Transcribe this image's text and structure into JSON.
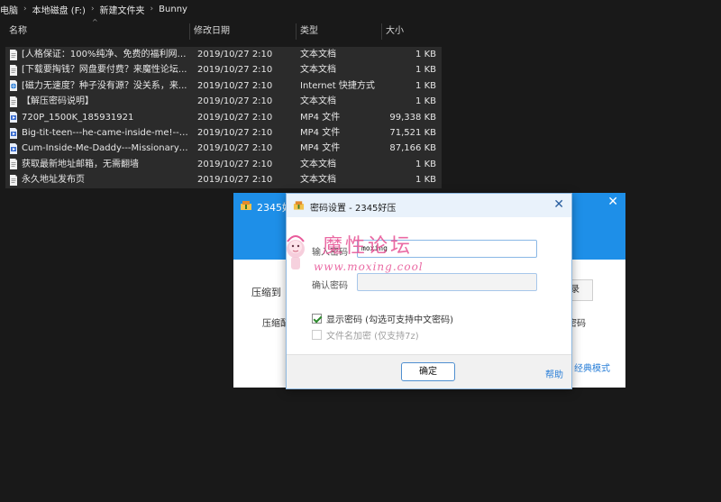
{
  "breadcrumb": [
    "电脑",
    "本地磁盘 (F:)",
    "新建文件夹",
    "Bunny"
  ],
  "columns": {
    "name": "名称",
    "date": "修改日期",
    "type": "类型",
    "size": "大小"
  },
  "files": [
    {
      "name": "[人格保证：100%纯净、免费的福利网站...",
      "date": "2019/10/27 2:10",
      "type": "文本文档",
      "size": "1 KB",
      "icon": "text-file-icon"
    },
    {
      "name": "[下载要掏钱？网盘要付费？来魔性论坛...",
      "date": "2019/10/27 2:10",
      "type": "文本文档",
      "size": "1 KB",
      "icon": "text-file-icon"
    },
    {
      "name": "[磁力无速度？种子没有源？没关系，来...",
      "date": "2019/10/27 2:10",
      "type": "Internet 快捷方式",
      "size": "1 KB",
      "icon": "internet-shortcut-icon"
    },
    {
      "name": "【解压密码说明】",
      "date": "2019/10/27 2:10",
      "type": "文本文档",
      "size": "1 KB",
      "icon": "text-file-icon"
    },
    {
      "name": "720P_1500K_185931921",
      "date": "2019/10/27 2:10",
      "type": "MP4 文件",
      "size": "99,338 KB",
      "icon": "video-file-icon"
    },
    {
      "name": "Big-tit-teen---he-came-inside-me!---...",
      "date": "2019/10/27 2:10",
      "type": "MP4 文件",
      "size": "71,521 KB",
      "icon": "video-file-icon"
    },
    {
      "name": "Cum-Inside-Me-Daddy---Missionary-...",
      "date": "2019/10/27 2:10",
      "type": "MP4 文件",
      "size": "87,166 KB",
      "icon": "video-file-icon"
    },
    {
      "name": "获取最新地址邮箱，无需翻墙",
      "date": "2019/10/27 2:10",
      "type": "文本文档",
      "size": "1 KB",
      "icon": "text-file-icon"
    },
    {
      "name": "永久地址发布页",
      "date": "2019/10/27 2:10",
      "type": "文本文档",
      "size": "1 KB",
      "icon": "text-file-icon"
    }
  ],
  "bg_window": {
    "title": "2345好",
    "label_compress": "压缩到",
    "label_compress2": "压缩配",
    "btn_right": "录",
    "label_right": "密码",
    "link_right": "经典模式"
  },
  "dialog": {
    "title": "密码设置 - 2345好压",
    "password_label": "输入密码",
    "password_value": "moxing",
    "confirm_label": "确认密码",
    "confirm_value": "",
    "show_password": {
      "label": "显示密码 (勾选可支持中文密码)",
      "checked": true
    },
    "encrypt_names": {
      "label": "文件名加密 (仅支持7z)",
      "checked": false,
      "disabled": true
    },
    "ok": "确定",
    "help": "帮助"
  },
  "watermark": {
    "title": "魔性论坛",
    "url": "www.moxing.cool"
  },
  "colors": {
    "explorer_bg": "#191919",
    "row_bg": "#2b2b2b",
    "title_blue": "#1e8fe8",
    "link_blue": "#2a7fd8",
    "watermark_pink": "#e85a9a"
  }
}
